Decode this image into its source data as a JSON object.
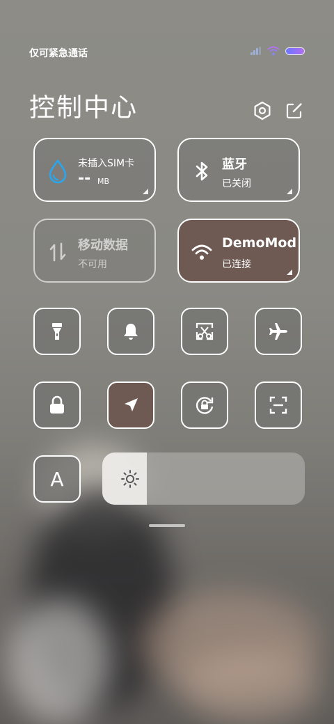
{
  "status_bar": {
    "carrier": "仅可紧急通话"
  },
  "header": {
    "title": "控制中心"
  },
  "tiles": {
    "data_usage": {
      "title": "未插入SIM卡",
      "value": "--",
      "unit": "MB"
    },
    "bluetooth": {
      "title": "蓝牙",
      "status": "已关闭"
    },
    "mobile_data": {
      "title": "移动数据",
      "status": "不可用"
    },
    "wifi": {
      "title": "DemoMod",
      "status": "已连接"
    }
  },
  "toggles_row1": [
    "flashlight-icon",
    "bell-icon",
    "screenshot-icon",
    "airplane-icon"
  ],
  "toggles_row2": [
    "lock-icon",
    "location-icon",
    "rotation-lock-icon",
    "scan-icon"
  ],
  "font_button": {
    "label": "A"
  },
  "brightness": {
    "level": 0.22
  },
  "colors": {
    "active_tile": "#6e5a52",
    "tile_bg": "#787876",
    "accent_blue": "#2aa6ee"
  }
}
